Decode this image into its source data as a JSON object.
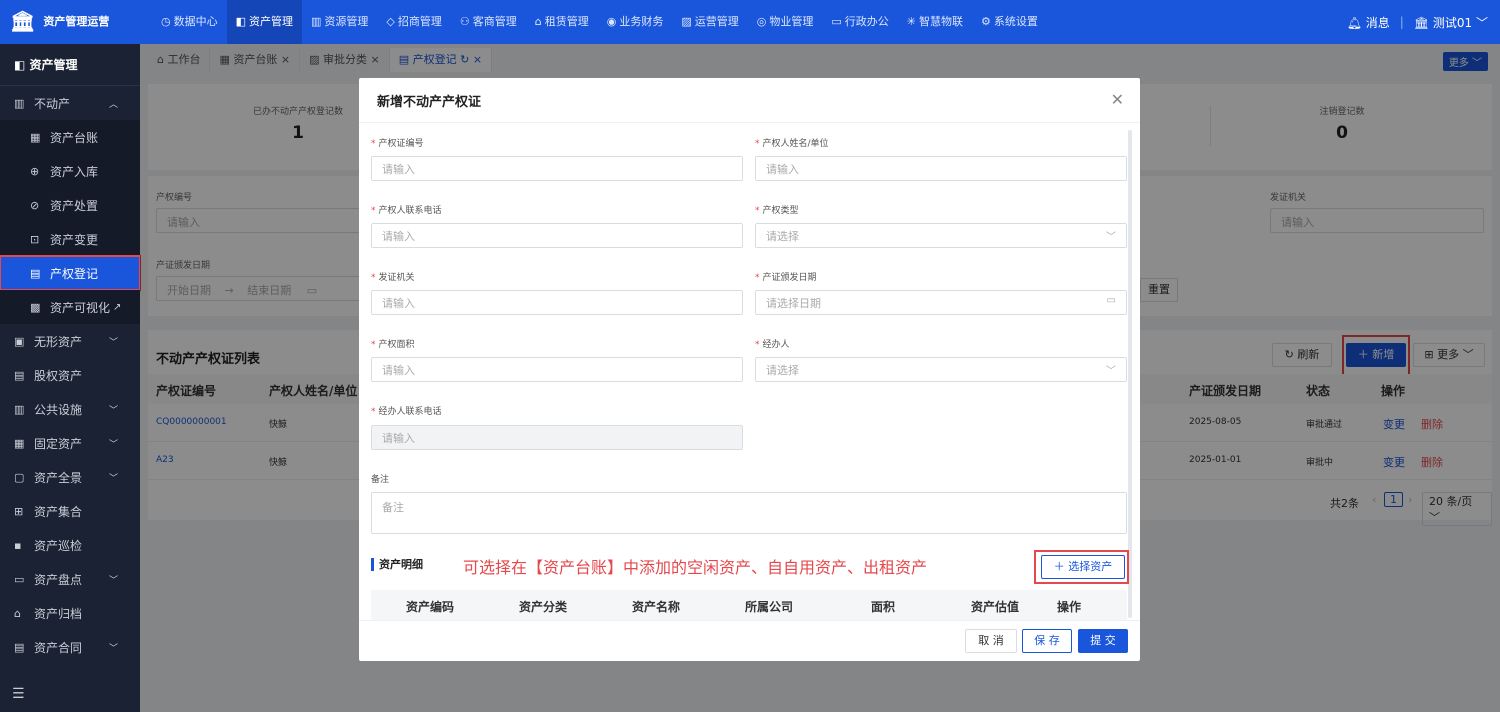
{
  "topbar": {
    "logo_text": "资产管理运营",
    "nav": [
      {
        "label": "数据中心",
        "icon": "clock-icon"
      },
      {
        "label": "资产管理",
        "icon": "cube-icon"
      },
      {
        "label": "资源管理",
        "icon": "building-icon"
      },
      {
        "label": "招商管理",
        "icon": "diamond-icon"
      },
      {
        "label": "客商管理",
        "icon": "users-icon"
      },
      {
        "label": "租赁管理",
        "icon": "house-icon"
      },
      {
        "label": "业务财务",
        "icon": "coin-icon"
      },
      {
        "label": "运营管理",
        "icon": "chart-icon"
      },
      {
        "label": "物业管理",
        "icon": "tool-icon"
      },
      {
        "label": "行政办公",
        "icon": "monitor-icon"
      },
      {
        "label": "智慧物联",
        "icon": "sparkle-icon"
      },
      {
        "label": "系统设置",
        "icon": "gear-icon"
      }
    ],
    "message_label": "消息",
    "user_label": "测试01"
  },
  "sidebar": {
    "header": "资产管理",
    "items": [
      {
        "label": "不动产",
        "icon": "building-icon",
        "level": 1,
        "expanded": true
      },
      {
        "label": "资产台账",
        "icon": "ledger-icon",
        "level": 2
      },
      {
        "label": "资产入库",
        "icon": "inbound-icon",
        "level": 2
      },
      {
        "label": "资产处置",
        "icon": "dispose-icon",
        "level": 2
      },
      {
        "label": "资产变更",
        "icon": "change-icon",
        "level": 2
      },
      {
        "label": "产权登记",
        "icon": "document-icon",
        "level": 2,
        "active": true
      },
      {
        "label": "资产可视化",
        "icon": "chart-icon",
        "level": 2,
        "external": true
      },
      {
        "label": "无形资产",
        "icon": "file-icon",
        "level": 1,
        "arrow": true
      },
      {
        "label": "股权资产",
        "icon": "stock-icon",
        "level": 1
      },
      {
        "label": "公共设施",
        "icon": "facility-icon",
        "level": 1,
        "arrow": true
      },
      {
        "label": "固定资产",
        "icon": "fixed-icon",
        "level": 1,
        "arrow": true
      },
      {
        "label": "资产全景",
        "icon": "panorama-icon",
        "level": 1,
        "arrow": true
      },
      {
        "label": "资产集合",
        "icon": "grid-icon",
        "level": 1
      },
      {
        "label": "资产巡检",
        "icon": "inspect-icon",
        "level": 1
      },
      {
        "label": "资产盘点",
        "icon": "inventory-icon",
        "level": 1,
        "arrow": true
      },
      {
        "label": "资产归档",
        "icon": "archive-icon",
        "level": 1
      },
      {
        "label": "资产合同",
        "icon": "contract-icon",
        "level": 1,
        "arrow": true
      }
    ]
  },
  "tabs": [
    {
      "label": "工作台",
      "closable": false
    },
    {
      "label": "资产台账",
      "closable": true
    },
    {
      "label": "审批分类",
      "closable": true
    },
    {
      "label": "产权登记",
      "closable": true,
      "active": true
    }
  ],
  "more_label": "更多",
  "stats": [
    {
      "label": "已办不动产产权登记数",
      "value": "1"
    },
    {
      "label": "注销登记数",
      "value": "0"
    }
  ],
  "filters": {
    "field1_label": "产权编号",
    "field1_placeholder": "请输入",
    "field2_label": "发证机关",
    "field2_placeholder": "请输入",
    "date_label": "产证颁发日期",
    "date_start": "开始日期",
    "date_sep": "→",
    "date_end": "结束日期",
    "reset": "重置"
  },
  "list": {
    "title": "不动产产权证列表",
    "refresh": "刷新",
    "add": "新增",
    "more": "更多",
    "columns": [
      "产权证编号",
      "产权人姓名/单位",
      "产证颁发日期",
      "状态",
      "操作"
    ],
    "rows": [
      {
        "code": "CQ0000000001",
        "owner": "快鲸",
        "date": "2025-08-05",
        "status": "审批通过",
        "edit": "变更",
        "delete": "删除"
      },
      {
        "code": "A23",
        "owner": "快鲸",
        "date": "2025-01-01",
        "status": "审批中",
        "edit": "变更",
        "delete": "删除"
      }
    ],
    "total": "共2条",
    "page": "1",
    "page_size": "20 条/页"
  },
  "modal": {
    "title": "新增不动产产权证",
    "fields": [
      {
        "label": "产权证编号",
        "placeholder": "请输入"
      },
      {
        "label": "产权人姓名/单位",
        "placeholder": "请输入"
      },
      {
        "label": "产权人联系电话",
        "placeholder": "请输入"
      },
      {
        "label": "产权类型",
        "placeholder": "请选择"
      },
      {
        "label": "发证机关",
        "placeholder": "请输入"
      },
      {
        "label": "产证颁发日期",
        "placeholder": "请选择日期"
      },
      {
        "label": "产权面积",
        "placeholder": "请输入"
      },
      {
        "label": "经办人",
        "placeholder": "请选择"
      },
      {
        "label": "经办人联系电话",
        "placeholder": "请输入"
      }
    ],
    "remark_label": "备注",
    "remark_placeholder": "备注",
    "section_title": "资产明细",
    "hint": "可选择在【资产台账】中添加的空闲资产、自自用资产、出租资产",
    "select_asset": "选择资产",
    "asset_columns": [
      "资产编码",
      "资产分类",
      "资产名称",
      "所属公司",
      "面积",
      "资产估值",
      "操作"
    ],
    "cancel": "取 消",
    "save": "保 存",
    "submit": "提 交"
  },
  "colors": {
    "brand": "#1a56db",
    "sidebar_bg": "#1b2233",
    "danger": "#e5484d"
  }
}
